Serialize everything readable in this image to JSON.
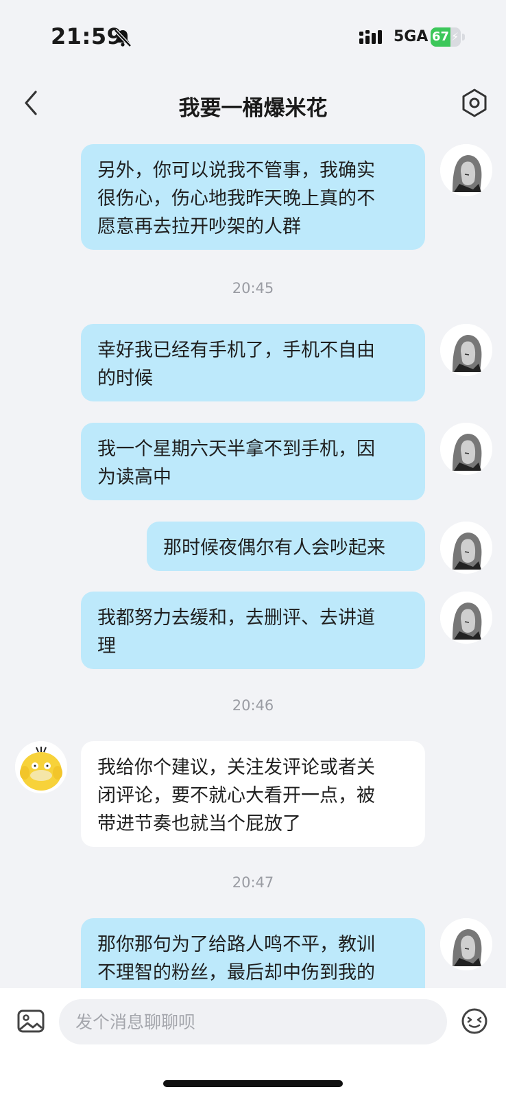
{
  "status_bar": {
    "time": "21:59",
    "network": "5GA",
    "battery": "67",
    "battery_level": 0.67,
    "icons": [
      "bell-slash-icon",
      "signal-icon",
      "battery-charging-icon"
    ]
  },
  "header": {
    "title": "我要一桶爆米花",
    "back_icon": "chevron-left-icon",
    "settings_icon": "hexagon-gear-icon"
  },
  "messages": [
    {
      "side": "out",
      "text": "另外，你可以说我不管事，我确实很伤心，伤心地我昨天晚上真的不愿意再去拉开吵架的人群",
      "lines": [
        "另外，你可以说我不管事，我确实",
        "很伤心，伤心地我昨天晚上真的不",
        "愿意再去拉开吵架的人群"
      ]
    },
    {
      "timestamp": "20:45"
    },
    {
      "side": "out",
      "lines": [
        "幸好我已经有手机了，手机不自由",
        "的时候"
      ]
    },
    {
      "side": "out",
      "lines": [
        "我一个星期六天半拿不到手机，因",
        "为读高中"
      ]
    },
    {
      "side": "out",
      "lines": [
        "那时候夜偶尔有人会吵起来"
      ]
    },
    {
      "side": "out",
      "lines": [
        "我都努力去缓和，去删评、去讲道",
        "理"
      ]
    },
    {
      "timestamp": "20:46"
    },
    {
      "side": "in",
      "lines": [
        "我给你个建议，关注发评论或者关",
        "闭评论，要不就心大看开一点，被",
        "带进节奏也就当个屁放了"
      ]
    },
    {
      "timestamp": "20:47"
    },
    {
      "side": "out",
      "lines": [
        "那你那句为了给路人鸣不平，教训",
        "不理智的粉丝，最后却中伤到我的"
      ]
    }
  ],
  "input": {
    "placeholder": "发个消息聊聊呗",
    "value": "",
    "image_icon": "image-icon",
    "emoji_icon": "emoji-face-icon"
  },
  "colors": {
    "background": "#f2f3f6",
    "outgoing_bubble": "#bde9fb",
    "incoming_bubble": "#ffffff",
    "battery_fill": "#3cc75a",
    "timestamp": "#9a9ca3"
  }
}
